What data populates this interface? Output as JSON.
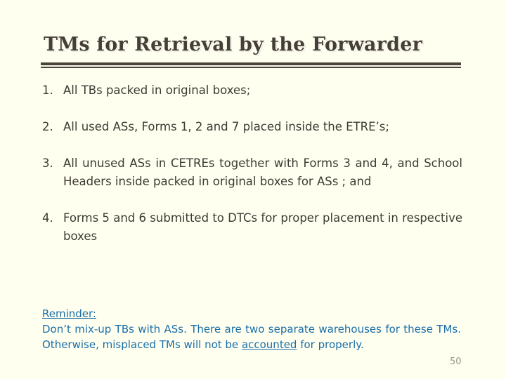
{
  "slide": {
    "title": "TMs for Retrieval by the Forwarder",
    "background_color": "#fffff0",
    "title_color": "#453f36",
    "body_color": "#3d3a33",
    "accent_color": "#1a6ea8",
    "rule_color": "#4a443b",
    "page_number": "50",
    "page_number_color": "#96948a"
  },
  "list": {
    "items": [
      {
        "number": "1.",
        "text": "All TBs packed in original boxes;"
      },
      {
        "number": "2.",
        "text": "All used ASs, Forms 1, 2 and 7 placed inside the ETRE’s;"
      },
      {
        "number": "3.",
        "text": "All unused ASs in CETREs together with Forms 3 and 4, and School Headers inside packed in original boxes for ASs ; and"
      },
      {
        "number": "4.",
        "text": "Forms 5 and 6 submitted to DTCs for proper placement in respective boxes"
      }
    ]
  },
  "reminder": {
    "heading": "Reminder:",
    "part1": "Don’t mix-up TBs with ASs. There are two separate warehouses for these TMs. Otherwise, misplaced TMs will not be ",
    "underlined_word": "accounted",
    "part2": " for properly."
  }
}
